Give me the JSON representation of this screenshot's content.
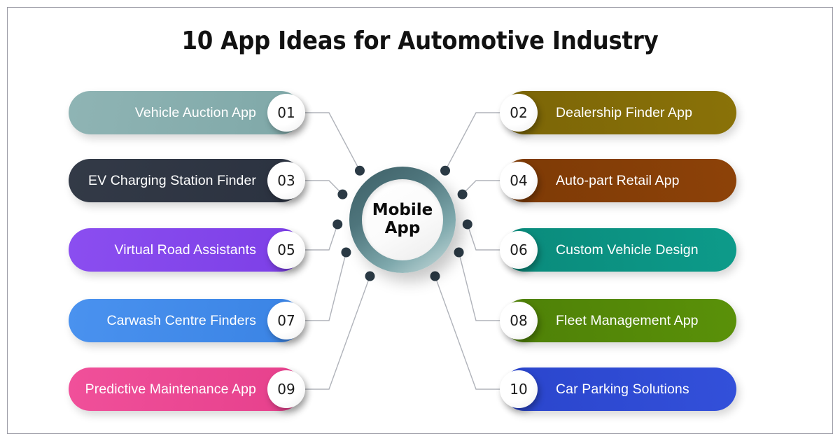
{
  "page": {
    "title": "10 App Ideas for Automotive Industry",
    "background_color": "#ffffff",
    "border_color": "#9c9ca6"
  },
  "hub": {
    "name": "mobile-app-hub",
    "line1": "Mobile",
    "line2": "App",
    "ring_color": "#4e757c",
    "inner_color": "#ffffff"
  },
  "connectors": {
    "line_color": "#b0b3ba",
    "dot_color": "#2b3a45",
    "dot_count": 10
  },
  "items": [
    {
      "number": "01",
      "label": "Vehicle Auction App",
      "side": "left",
      "color": "#8fb4b4",
      "color_dark": "#7fa8a8"
    },
    {
      "number": "02",
      "label": "Dealership Finder App",
      "side": "right",
      "color": "#8a7208",
      "color_dark": "#7b6507"
    },
    {
      "number": "03",
      "label": "EV Charging Station Finder",
      "side": "left",
      "color": "#333a47",
      "color_dark": "#2b3240"
    },
    {
      "number": "04",
      "label": "Auto-part Retail App",
      "side": "right",
      "color": "#8d4208",
      "color_dark": "#7d3a06"
    },
    {
      "number": "05",
      "label": "Virtual Road Assistants",
      "side": "left",
      "color": "#8b4ef0",
      "color_dark": "#7c3fe6"
    },
    {
      "number": "06",
      "label": "Custom Vehicle Design",
      "side": "right",
      "color": "#0d9b8a",
      "color_dark": "#0a8a7b"
    },
    {
      "number": "07",
      "label": "Carwash Centre Finders",
      "side": "left",
      "color": "#4a92ef",
      "color_dark": "#3a83e4"
    },
    {
      "number": "08",
      "label": "Fleet Management App",
      "side": "right",
      "color": "#5a9109",
      "color_dark": "#4e8007"
    },
    {
      "number": "09",
      "label": "Predictive Maintenance App",
      "side": "left",
      "color": "#f0509a",
      "color_dark": "#e6408c"
    },
    {
      "number": "10",
      "label": "Car Parking Solutions",
      "side": "right",
      "color": "#3350da",
      "color_dark": "#2a45cc"
    }
  ]
}
